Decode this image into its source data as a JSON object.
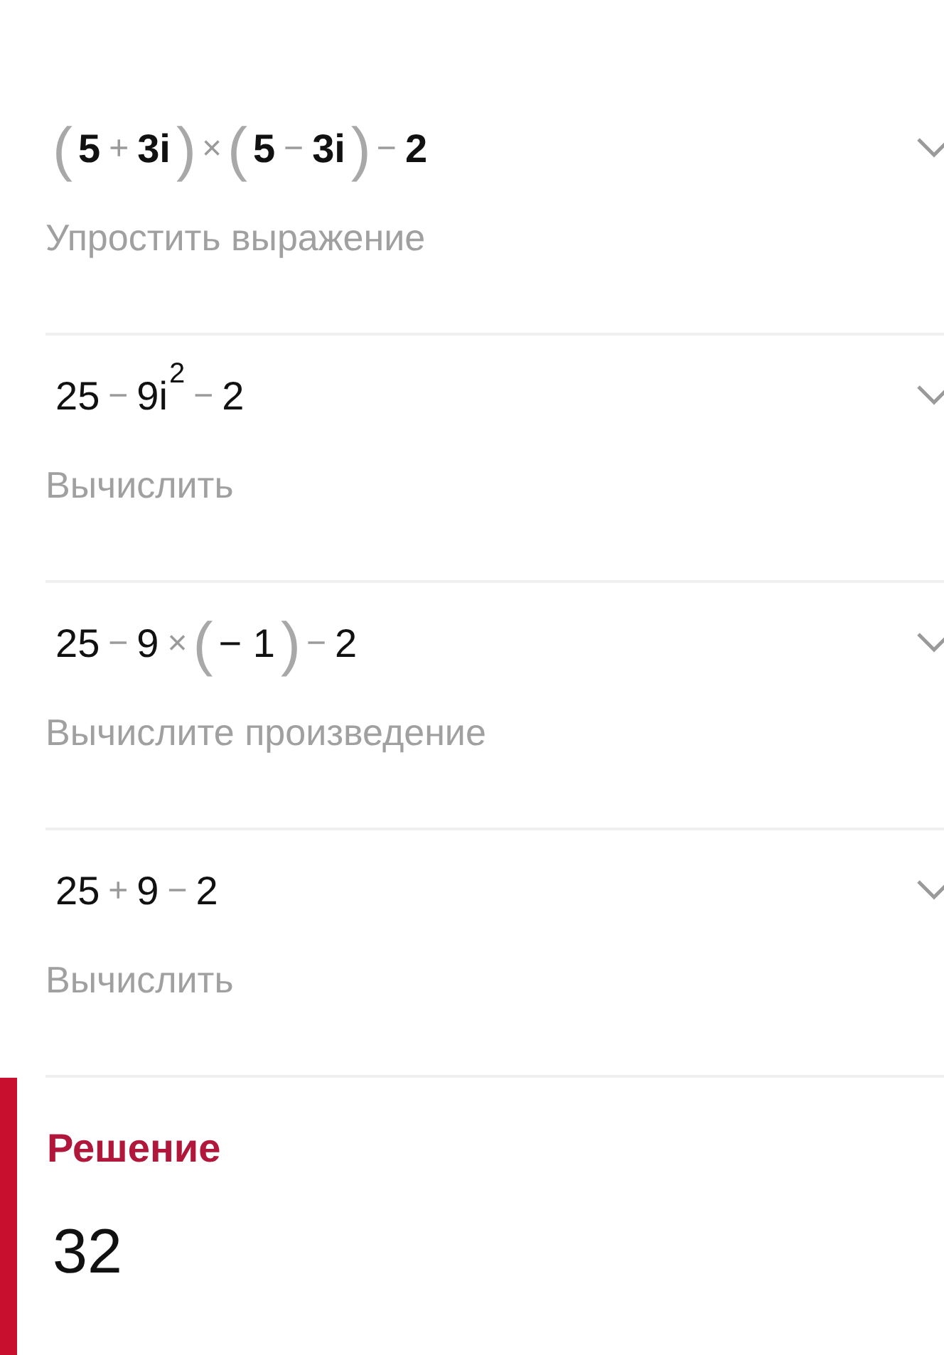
{
  "steps": [
    {
      "bold": true,
      "expression": [
        {
          "kind": "paren",
          "text": "("
        },
        {
          "kind": "num",
          "text": "5"
        },
        {
          "kind": "op",
          "text": "+"
        },
        {
          "kind": "num",
          "text": "3i"
        },
        {
          "kind": "paren",
          "text": ")"
        },
        {
          "kind": "op",
          "text": "×"
        },
        {
          "kind": "paren",
          "text": "("
        },
        {
          "kind": "num",
          "text": "5"
        },
        {
          "kind": "op",
          "text": "−"
        },
        {
          "kind": "num",
          "text": "3i"
        },
        {
          "kind": "paren",
          "text": ")"
        },
        {
          "kind": "op",
          "text": "−"
        },
        {
          "kind": "num",
          "text": "2"
        }
      ],
      "description": "Упростить выражение"
    },
    {
      "bold": false,
      "expression": [
        {
          "kind": "num",
          "text": "25"
        },
        {
          "kind": "op",
          "text": "−"
        },
        {
          "kind": "num",
          "text": "9i"
        },
        {
          "kind": "sup",
          "text": "2"
        },
        {
          "kind": "op",
          "text": "−"
        },
        {
          "kind": "num",
          "text": "2"
        }
      ],
      "description": "Вычислить"
    },
    {
      "bold": false,
      "expression": [
        {
          "kind": "num",
          "text": "25"
        },
        {
          "kind": "op",
          "text": "−"
        },
        {
          "kind": "num",
          "text": "9"
        },
        {
          "kind": "op",
          "text": "×"
        },
        {
          "kind": "paren",
          "text": "("
        },
        {
          "kind": "num",
          "text": "− 1"
        },
        {
          "kind": "paren",
          "text": ")"
        },
        {
          "kind": "op",
          "text": "−"
        },
        {
          "kind": "num",
          "text": "2"
        }
      ],
      "description": "Вычислите произведение"
    },
    {
      "bold": false,
      "expression": [
        {
          "kind": "num",
          "text": "25"
        },
        {
          "kind": "op",
          "text": "+"
        },
        {
          "kind": "num",
          "text": "9"
        },
        {
          "kind": "op",
          "text": "−"
        },
        {
          "kind": "num",
          "text": "2"
        }
      ],
      "description": "Вычислить"
    }
  ],
  "solution": {
    "title": "Решение",
    "value": "32"
  }
}
